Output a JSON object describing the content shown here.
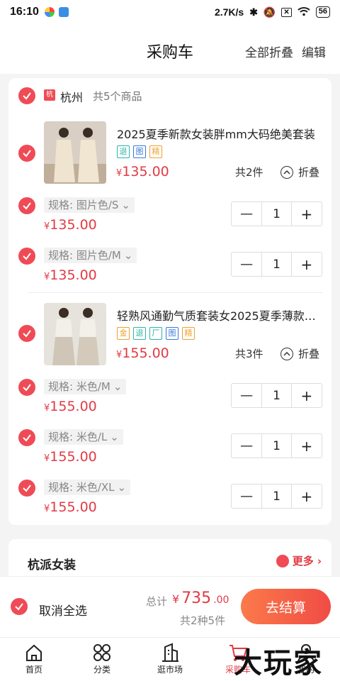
{
  "status_bar": {
    "time": "16:10",
    "speed": "2.7K/s",
    "battery": "56"
  },
  "header": {
    "title": "采购车",
    "collapse_all": "全部折叠",
    "edit": "编辑"
  },
  "store": {
    "badge": "杭",
    "name": "杭州",
    "count": "共5个商品"
  },
  "products": [
    {
      "title": "2025夏季新款女装胖mm大码绝美套装",
      "tags": [
        "退",
        "图",
        "精"
      ],
      "price_symbol": "¥",
      "price": "135.00",
      "count": "共2件",
      "fold": "折叠",
      "variants": [
        {
          "spec": "规格: 图片色/S",
          "price": "135.00",
          "qty": "1"
        },
        {
          "spec": "规格: 图片色/M",
          "price": "135.00",
          "qty": "1"
        }
      ]
    },
    {
      "title": "轻熟风通勤气质套装女2025夏季薄款阔腿裤",
      "tags": [
        "金",
        "退",
        "厂",
        "图",
        "精"
      ],
      "price_symbol": "¥",
      "price": "155.00",
      "count": "共3件",
      "fold": "折叠",
      "variants": [
        {
          "spec": "规格: 米色/M",
          "price": "155.00",
          "qty": "1"
        },
        {
          "spec": "规格: 米色/L",
          "price": "155.00",
          "qty": "1"
        },
        {
          "spec": "规格: 米色/XL",
          "price": "155.00",
          "qty": "1"
        }
      ]
    }
  ],
  "stepper": {
    "minus": "—",
    "plus": "+"
  },
  "store2": {
    "name": "杭派女装",
    "more": "更多"
  },
  "checkout": {
    "deselect_all": "取消全选",
    "total_label": "总计",
    "currency": "¥",
    "total_int": "735",
    "total_dec": ".00",
    "kinds": "共2种5件",
    "pay": "去结算"
  },
  "tabs": [
    {
      "label": "首页",
      "icon": "home-icon"
    },
    {
      "label": "分类",
      "icon": "category-icon"
    },
    {
      "label": "逛市场",
      "icon": "market-icon"
    },
    {
      "label": "采购车",
      "icon": "cart-icon"
    },
    {
      "label": "我的",
      "icon": "profile-icon"
    }
  ],
  "watermark": "大玩家",
  "colors": {
    "accent": "#ef4b56",
    "price": "#e23a44",
    "tag_teal": "#2bb5a8",
    "tag_blue": "#3a79d8",
    "tag_orange": "#f0a030"
  }
}
